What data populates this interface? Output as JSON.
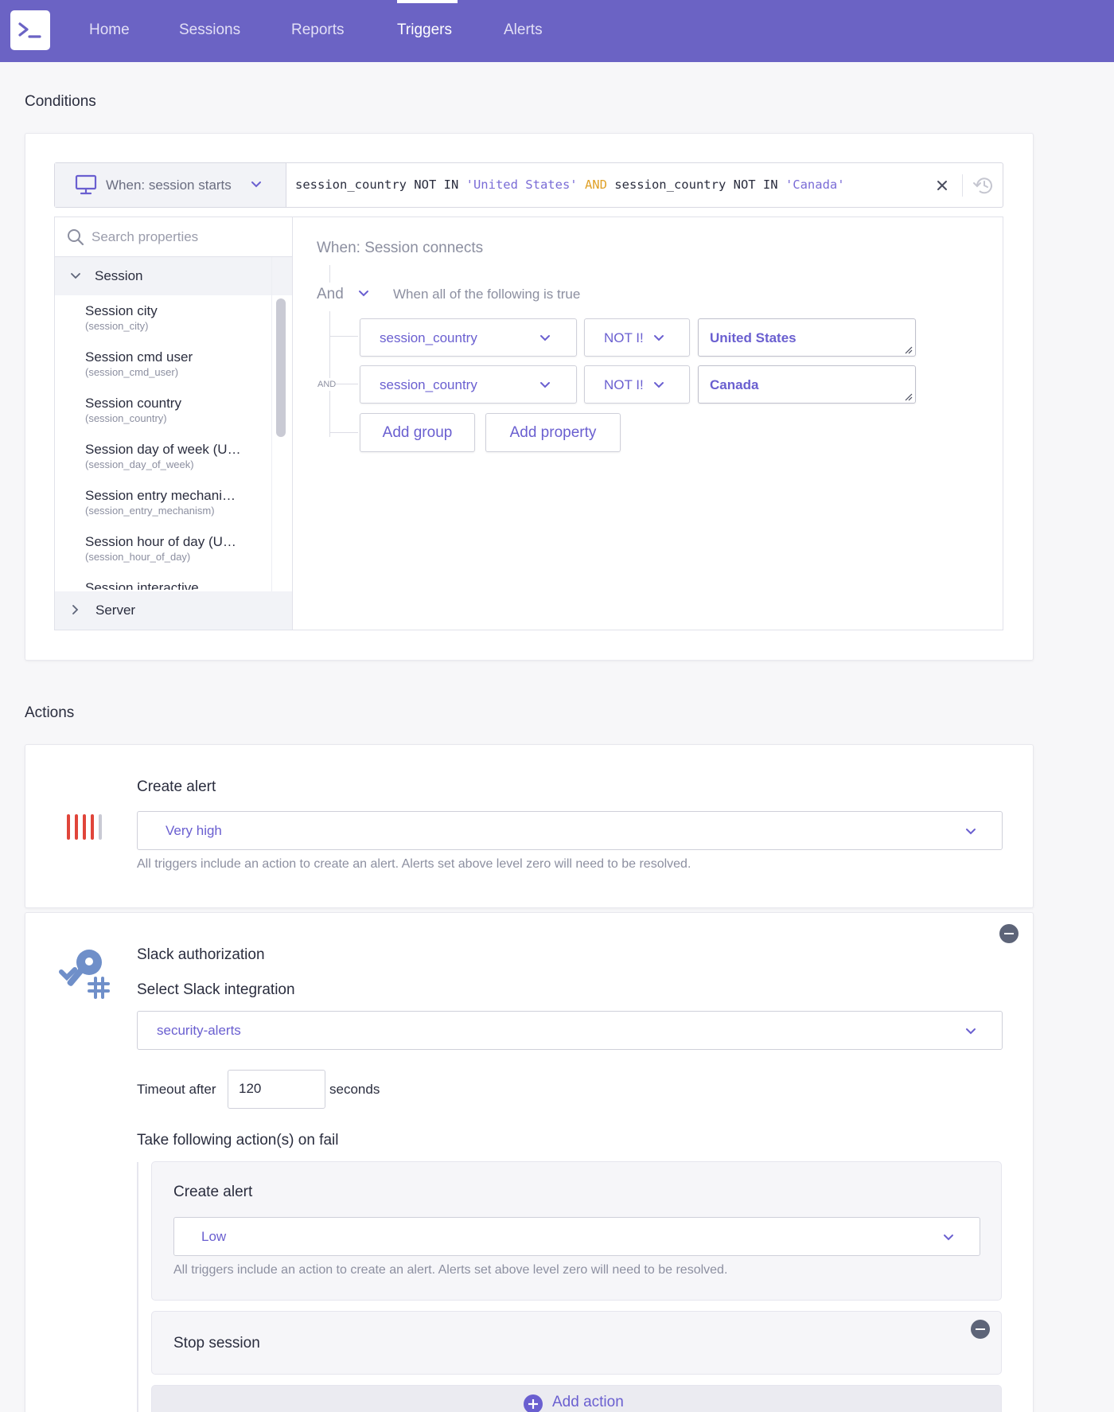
{
  "nav": {
    "logo_icon": "terminal-prompt-icon",
    "items": [
      "Home",
      "Sessions",
      "Reports",
      "Triggers",
      "Alerts"
    ],
    "active": "Triggers"
  },
  "conditions": {
    "section_title": "Conditions",
    "when_label": "When: session starts",
    "query": {
      "p1": "session_country NOT IN ",
      "s1": "'United States'",
      "and": "AND",
      "p2": " session_country NOT IN ",
      "s2": "'Canada'"
    },
    "search_placeholder": "Search properties",
    "groups": {
      "session": "Session",
      "server": "Server"
    },
    "properties": [
      {
        "name": "Session city",
        "key": "(session_city)"
      },
      {
        "name": "Session cmd user",
        "key": "(session_cmd_user)"
      },
      {
        "name": "Session country",
        "key": "(session_country)"
      },
      {
        "name": "Session day of week (U…",
        "key": "(session_day_of_week)"
      },
      {
        "name": "Session entry mechani…",
        "key": "(session_entry_mechanism)"
      },
      {
        "name": "Session hour of day (U…",
        "key": "(session_hour_of_day)"
      },
      {
        "name": "Session interactive",
        "key": ""
      }
    ],
    "builder": {
      "heading": "When: Session connects",
      "logic": "And",
      "logic_desc": "When all of the following is true",
      "and_label": "AND",
      "rows": [
        {
          "property": "session_country",
          "operator": "NOT I!",
          "value": "United States"
        },
        {
          "property": "session_country",
          "operator": "NOT I!",
          "value": "Canada"
        }
      ],
      "add_group": "Add group",
      "add_property": "Add property"
    }
  },
  "actions": {
    "section_title": "Actions",
    "create_alert": {
      "label": "Create alert",
      "level": "Very high",
      "help": "All triggers include an action to create an alert. Alerts set above level zero will need to be resolved."
    },
    "slack": {
      "title": "Slack authorization",
      "select_label": "Select Slack integration",
      "integration": "security-alerts",
      "timeout_prefix": "Timeout after",
      "timeout_value": "120",
      "timeout_suffix": "seconds",
      "fail_label": "Take following action(s) on fail",
      "fail_alert": {
        "label": "Create alert",
        "level": "Low",
        "help": "All triggers include an action to create an alert. Alerts set above level zero will need to be resolved."
      },
      "stop_session": "Stop session",
      "add_action": "Add action"
    }
  },
  "colors": {
    "brand": "#6b63c4",
    "accent_text": "#6a5fd0",
    "alert_red": "#e0453a",
    "slack_icon": "#6f8fc9"
  }
}
